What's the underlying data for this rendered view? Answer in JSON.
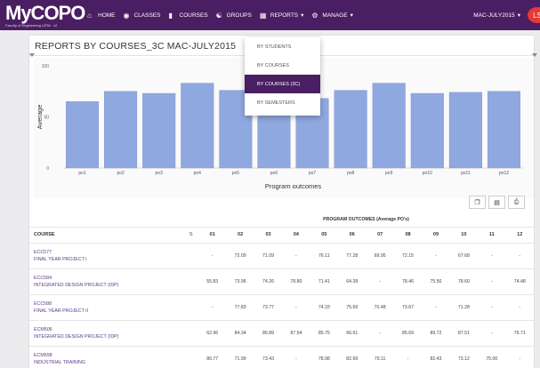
{
  "brand": {
    "name": "MyCOPO",
    "tagline": "Faculty of Engineering UiTM - v2"
  },
  "nav": {
    "items": [
      {
        "label": "HOME",
        "icon": "home-icon"
      },
      {
        "label": "CLASSES",
        "icon": "classes-icon"
      },
      {
        "label": "COURSES",
        "icon": "book-icon"
      },
      {
        "label": "GROUPS",
        "icon": "groups-icon"
      },
      {
        "label": "REPORTS",
        "icon": "reports-icon",
        "caret": true
      },
      {
        "label": "MANAGE",
        "icon": "gear-icon",
        "caret": true
      }
    ],
    "session": "MAC-JULY2015",
    "user_initials": "LS"
  },
  "dropdown": {
    "items": [
      {
        "label": "BY STUDENTS",
        "active": false
      },
      {
        "label": "BY COURSES",
        "active": false
      },
      {
        "label": "BY COURSES (3C)",
        "active": true
      },
      {
        "label": "BY SEMESTERS",
        "active": false
      }
    ]
  },
  "page": {
    "title": "REPORTS BY COURSES_3C MAC-JULY2015"
  },
  "chart_data": {
    "type": "bar",
    "categories": [
      "po1",
      "po2",
      "po3",
      "po4",
      "po5",
      "po6",
      "po7",
      "po8",
      "po9",
      "po10",
      "po11",
      "po12"
    ],
    "values": [
      65,
      75,
      73,
      83,
      76,
      74,
      68,
      76,
      83,
      73,
      74,
      75
    ],
    "xlabel": "Program outcomes",
    "ylabel": "Average",
    "ylim": [
      0,
      100
    ],
    "yticks": [
      0,
      50,
      100
    ],
    "color": "#90a8e0",
    "grid": false
  },
  "table": {
    "group_header": "PROGRAM OUTCOMES (Average PO's)",
    "course_header": "COURSE",
    "columns": [
      "01",
      "02",
      "03",
      "04",
      "05",
      "06",
      "07",
      "08",
      "09",
      "10",
      "11",
      "12"
    ],
    "rows": [
      {
        "code": "ECC577",
        "name": "FINAL YEAR PROJECT I",
        "values": [
          "-",
          "72.09",
          "71.09",
          "-",
          "76.11",
          "77.28",
          "69.95",
          "72.15",
          "-",
          "67.68",
          "-",
          "-"
        ]
      },
      {
        "code": "ECC584",
        "name": "INTEGRATED DESIGN PROJECT (IDP)",
        "values": [
          "55.83",
          "73.96",
          "74.26",
          "78.80",
          "71.41",
          "64.39",
          "-",
          "78.46",
          "75.56",
          "78.60",
          "-",
          "74.48"
        ]
      },
      {
        "code": "ECC588",
        "name": "FINAL YEAR PROJECT II",
        "values": [
          "-",
          "77.83",
          "73.77",
          "-",
          "74.33",
          "75.69",
          "70.48",
          "73.67",
          "-",
          "71.28",
          "-",
          "-"
        ]
      },
      {
        "code": "ECM506",
        "name": "INTEGRATED DESIGN PROJECT (IDP)",
        "values": [
          "62.96",
          "84.34",
          "80.89",
          "87.54",
          "85.75",
          "66.61",
          "-",
          "85.69",
          "89.72",
          "87.51",
          "-",
          "76.71"
        ]
      },
      {
        "code": "ECM598",
        "name": "INDUSTRIAL TRAINING",
        "values": [
          "80.77",
          "71.99",
          "73.43",
          "-",
          "78.98",
          "82.69",
          "79.11",
          "-",
          "82.43",
          "73.12",
          "75.00",
          "-"
        ]
      }
    ]
  },
  "tools": [
    {
      "name": "copy-icon"
    },
    {
      "name": "excel-icon"
    },
    {
      "name": "print-icon"
    }
  ]
}
